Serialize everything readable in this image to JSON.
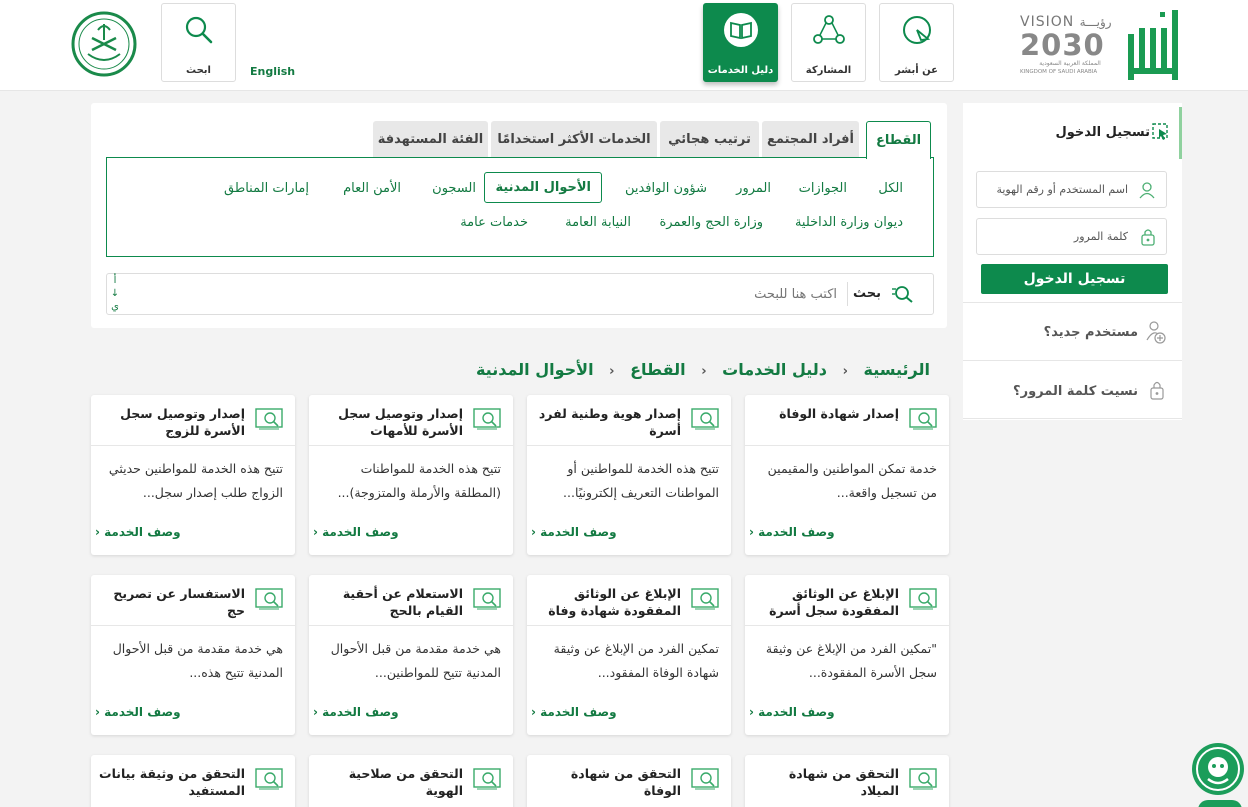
{
  "header": {
    "nav": [
      {
        "label": "عن أبشر",
        "icon": "about-icon"
      },
      {
        "label": "المشاركة",
        "icon": "share-icon"
      },
      {
        "label": "دليل الخدمات",
        "icon": "book-icon",
        "active": true
      }
    ],
    "search_label": "ابحث",
    "lang_label": "English",
    "vision": {
      "title": "VISION",
      "arabic": "رؤيـــة",
      "year": "2030",
      "sub_ar": "المملكة العربية السعودية",
      "sub_en": "KINGDOM OF SAUDI ARABIA"
    }
  },
  "filter": {
    "tabs": [
      "القطاع",
      "أفراد المجتمع",
      "ترتيب هجائي",
      "الخدمات الأكثر استخدامًا",
      "الفئة المستهدفة"
    ],
    "active_tab": "القطاع",
    "chips_row1": [
      "الكل",
      "الجوازات",
      "المرور",
      "شؤون الوافدين",
      "الأحوال المدنية",
      "السجون",
      "الأمن العام",
      "إمارات المناطق"
    ],
    "chips_row2": [
      "ديوان وزارة الداخلية",
      "وزارة الحج والعمرة",
      "النيابة العامة",
      "خدمات عامة"
    ],
    "selected_chip": "الأحوال المدنية",
    "search_button": "بحث",
    "search_placeholder": "اكتب هنا للبحث",
    "scroll_marks": [
      "أ",
      "↓",
      "ي"
    ]
  },
  "breadcrumb": [
    "الرئيسية",
    "دليل الخدمات",
    "القطاع",
    "الأحوال المدنية"
  ],
  "cards": [
    {
      "title": "إصدار شهادة الوفاة",
      "desc": "خدمة تمكن المواطنين والمقيمين من تسجيل واقعة...",
      "link": "وصف الخدمة"
    },
    {
      "title": "إصدار هوية وطنية لفرد أسرة",
      "desc": "تتيح هذه الخدمة للمواطنين أو المواطنات التعريف إلكترونيًا...",
      "link": "وصف الخدمة"
    },
    {
      "title": "إصدار وتوصيل سجل الأسرة للأمهات",
      "desc": "تتيح هذه الخدمة للمواطنات (المطلقة والأرملة والمتزوجة)...",
      "link": "وصف الخدمة"
    },
    {
      "title": "إصدار وتوصيل سجل الأسرة للزوج",
      "desc": "تتيح هذه الخدمة للمواطنين حديثي الزواج طلب إصدار سجل...",
      "link": "وصف الخدمة"
    },
    {
      "title": "الإبلاغ عن الوثائق المفقودة سجل أسرة",
      "desc": "\"تمكين الفرد من الإبلاغ عن وثيقة سجل الأسرة المفقودة...",
      "link": "وصف الخدمة"
    },
    {
      "title": "الإبلاغ عن الوثائق المفقودة شهادة وفاة",
      "desc": "تمكين الفرد من الإبلاغ عن وثيقة شهادة الوفاة المفقود...",
      "link": "وصف الخدمة"
    },
    {
      "title": "الاستعلام عن أحقية القيام بالحج",
      "desc": "هي خدمة مقدمة من قبل الأحوال المدنية تتيح للمواطنين...",
      "link": "وصف الخدمة"
    },
    {
      "title": "الاستفسار عن تصريح حج",
      "desc": "هي خدمة مقدمة من قبل الأحوال المدنية تتيح هذه...",
      "link": "وصف الخدمة"
    },
    {
      "title": "التحقق من شهادة الميلاد",
      "desc": "",
      "link": ""
    },
    {
      "title": "التحقق من شهادة الوفاة",
      "desc": "",
      "link": ""
    },
    {
      "title": "التحقق من صلاحية الهوية",
      "desc": "",
      "link": ""
    },
    {
      "title": "التحقق من وثيقة بيانات المستفيد",
      "desc": "",
      "link": ""
    }
  ],
  "login": {
    "title": "تسجيل الدخول",
    "username_placeholder": "اسم المستخدم أو رقم الهوية",
    "password_placeholder": "كلمة المرور",
    "button": "تسجيل الدخول",
    "new_user": "مستخدم جديد؟",
    "forgot": "نسيت كلمة المرور؟"
  },
  "colors": {
    "brand": "#0d8a4d",
    "text_green": "#137a42",
    "bg": "#f3f3f3"
  }
}
